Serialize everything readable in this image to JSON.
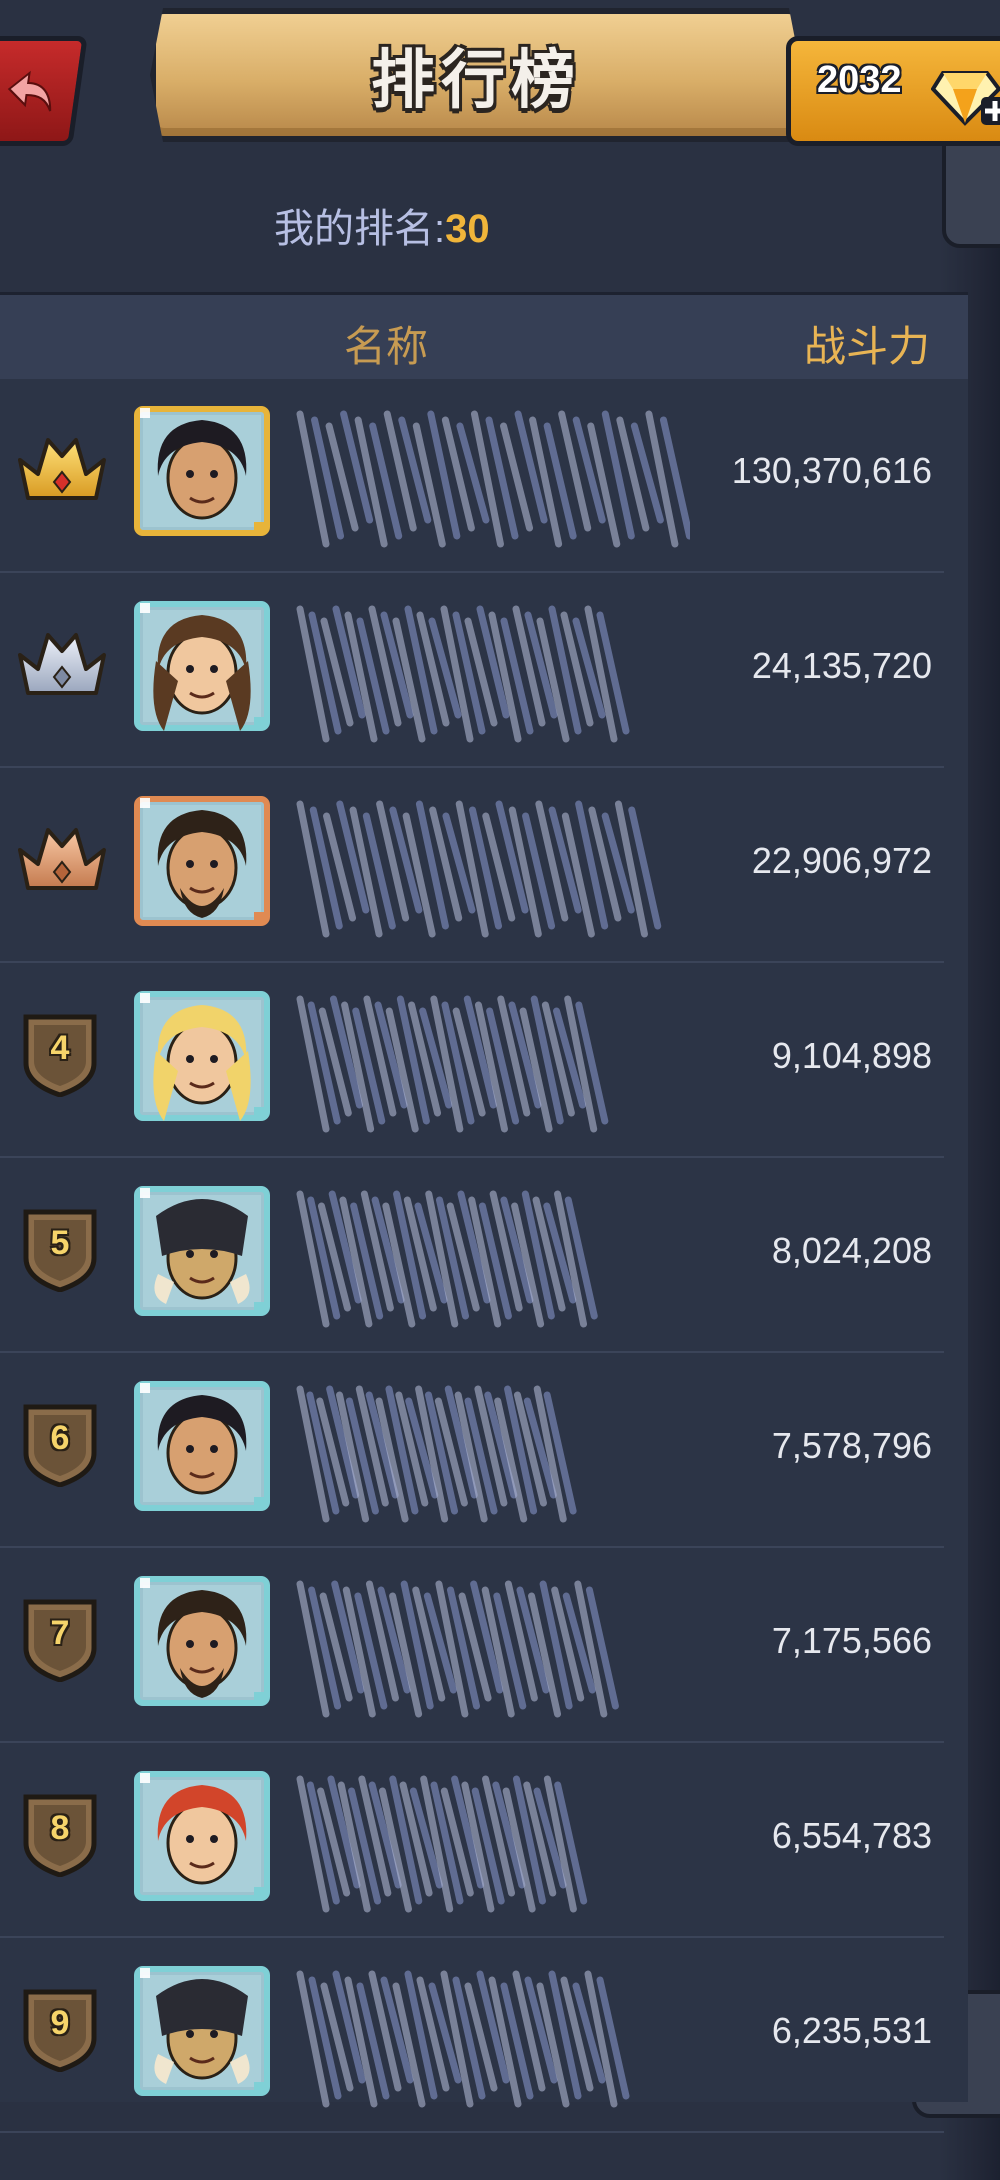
{
  "header": {
    "title": "排行榜",
    "gems": "2032"
  },
  "my_rank": {
    "label": "我的排名:",
    "value": "30"
  },
  "table": {
    "col_name": "名称",
    "col_power": "战斗力",
    "rows": [
      {
        "rank": "1",
        "badge": "gold-crown",
        "avatar": "warrior-dark-hair",
        "frame": "gold",
        "power": "130,370,616"
      },
      {
        "rank": "2",
        "badge": "silver-crown",
        "avatar": "woman-brown-hair",
        "frame": "teal",
        "power": "24,135,720"
      },
      {
        "rank": "3",
        "badge": "bronze-crown",
        "avatar": "bearded-warrior",
        "frame": "bronze",
        "power": "22,906,972"
      },
      {
        "rank": "4",
        "badge": "shield",
        "avatar": "blonde-woman",
        "frame": "teal",
        "power": "9,104,898"
      },
      {
        "rank": "5",
        "badge": "shield",
        "avatar": "helmeted-warrior",
        "frame": "teal",
        "power": "8,024,208"
      },
      {
        "rank": "6",
        "badge": "shield",
        "avatar": "warrior-dark-hair",
        "frame": "teal",
        "power": "7,578,796"
      },
      {
        "rank": "7",
        "badge": "shield",
        "avatar": "bearded-warrior",
        "frame": "teal",
        "power": "7,175,566"
      },
      {
        "rank": "8",
        "badge": "shield",
        "avatar": "red-haired-woman",
        "frame": "teal",
        "power": "6,554,783"
      },
      {
        "rank": "9",
        "badge": "shield",
        "avatar": "helmeted-warrior",
        "frame": "teal",
        "power": "6,235,531"
      }
    ]
  },
  "colors": {
    "background": "#2a3142",
    "accent_gold": "#f0b53a",
    "rank_label": "#b7bfe3",
    "frame_gold": "#e8b43a",
    "frame_teal": "#7fd0d6",
    "frame_bronze": "#e08a52"
  }
}
